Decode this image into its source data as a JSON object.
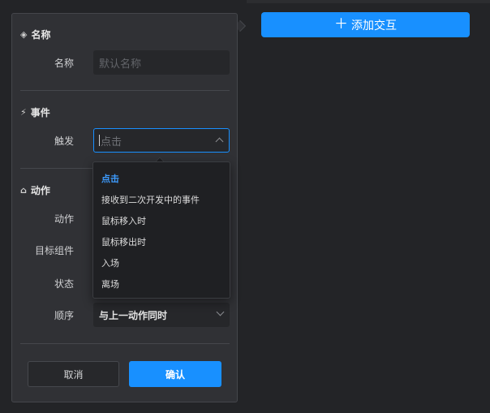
{
  "toolbar": {
    "add_interaction_label": "添加交互"
  },
  "panel": {
    "name_section": {
      "title": "名称",
      "icon": "diamond-icon",
      "field_label": "名称",
      "placeholder": "默认名称"
    },
    "event_section": {
      "title": "事件",
      "icon": "lightning-icon",
      "trigger_label": "触发",
      "trigger_value": "点击"
    },
    "action_section": {
      "title": "动作",
      "icon": "action-icon",
      "action_label": "动作",
      "target_label": "目标组件",
      "state_label": "状态",
      "order_label": "顺序",
      "order_value": "与上一动作同时"
    },
    "cancel_label": "取消",
    "confirm_label": "确认"
  },
  "dropdown": {
    "options": [
      {
        "label": "点击",
        "selected": true
      },
      {
        "label": "接收到二次开发中的事件",
        "selected": false
      },
      {
        "label": "鼠标移入时",
        "selected": false
      },
      {
        "label": "鼠标移出时",
        "selected": false
      },
      {
        "label": "入场",
        "selected": false
      },
      {
        "label": "离场",
        "selected": false
      }
    ]
  },
  "colors": {
    "accent": "#1890ff",
    "panel_bg": "#303135",
    "page_bg": "#232427"
  }
}
